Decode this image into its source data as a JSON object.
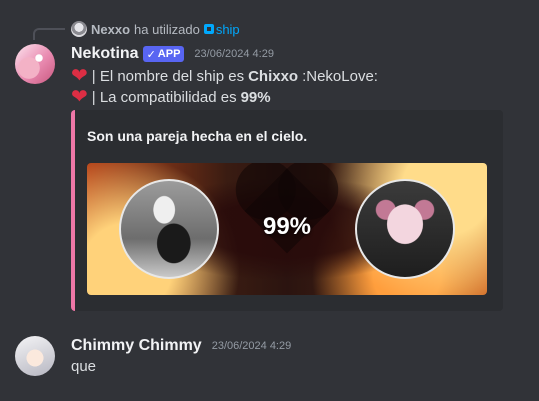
{
  "reply": {
    "user": "Nexxo",
    "action": "ha utilizado",
    "command": "ship"
  },
  "message1": {
    "username": "Nekotina",
    "app_tag": "APP",
    "timestamp": "23/06/2024 4:29",
    "line1_prefix": "| El nombre del ship es",
    "line1_bold": "Chixxo",
    "line1_suffix": ":NekoLove:",
    "line2_prefix": "| La compatibilidad es",
    "line2_bold": "99%",
    "embed": {
      "description": "Son una pareja hecha en el cielo.",
      "percent": "99%",
      "border_color": "#ee77a7"
    }
  },
  "message2": {
    "username": "Chimmy Chimmy",
    "timestamp": "23/06/2024 4:29",
    "content": "que"
  },
  "colors": {
    "background": "#313338",
    "embed_bg": "#2b2d31",
    "app_tag": "#5865f2",
    "command_link": "#00a8fc",
    "heart": "#dd2e44"
  },
  "icons": [
    "reply-avatar-icon",
    "slash-command-icon",
    "checkmark-icon",
    "heart-icon"
  ]
}
